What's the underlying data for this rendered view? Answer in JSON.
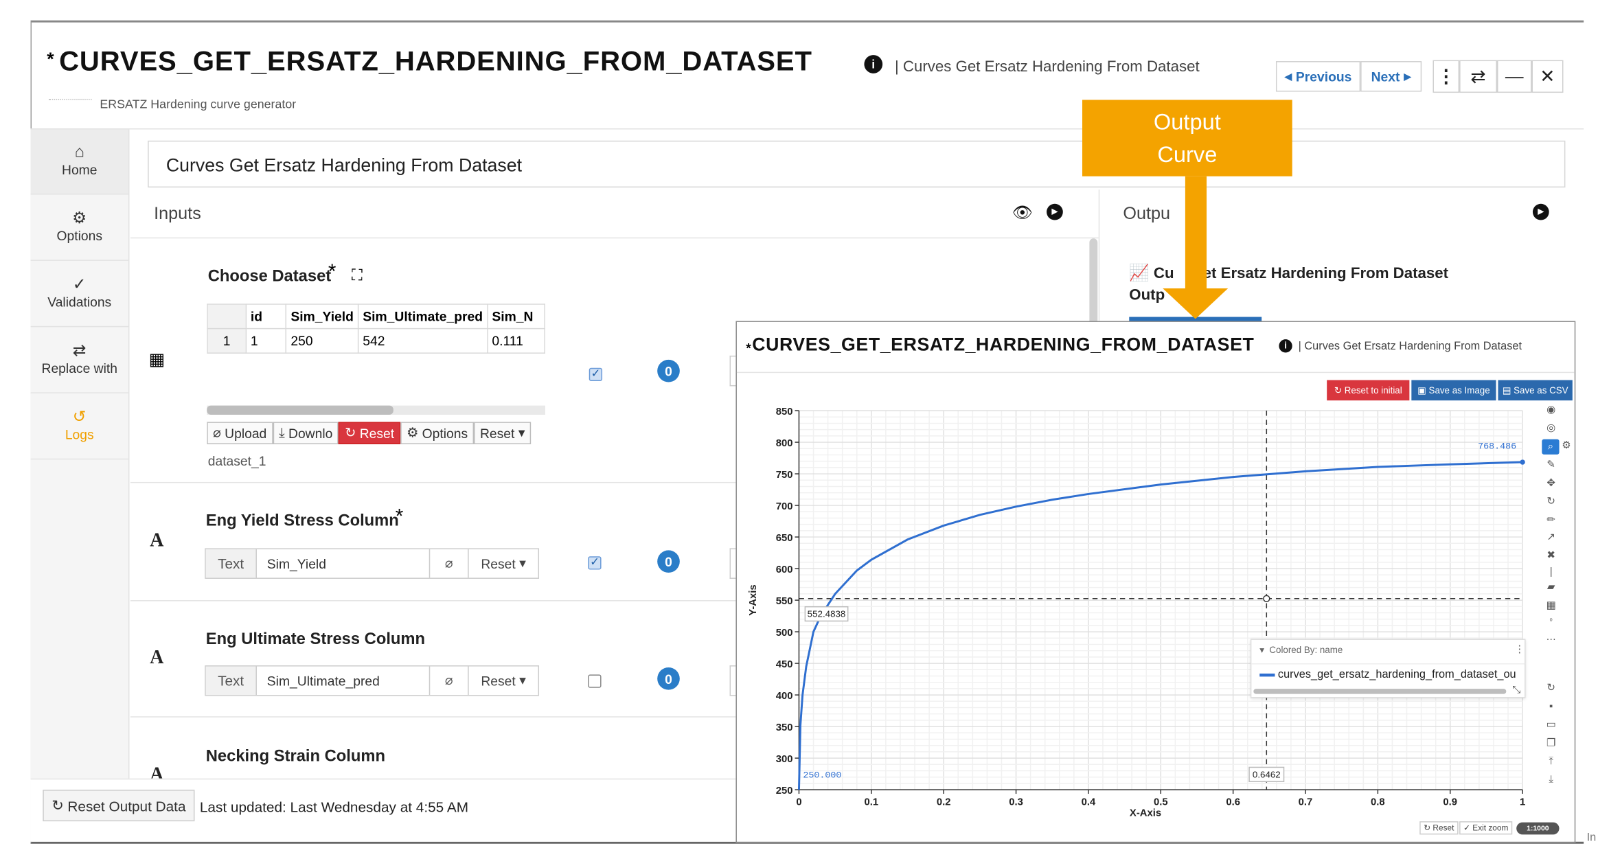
{
  "header": {
    "title_prefix": "*",
    "title": "CURVES_GET_ERSATZ_HARDENING_FROM_DATASET",
    "subtitle": "| Curves Get Ersatz Hardening From Dataset",
    "description": "ERSATZ Hardening curve generator",
    "previous_label": "Previous",
    "next_label": "Next"
  },
  "sidebar": {
    "items": [
      {
        "label": "Home"
      },
      {
        "label": "Options"
      },
      {
        "label": "Validations"
      },
      {
        "label": "Replace with"
      },
      {
        "label": "Logs"
      }
    ]
  },
  "name_field": {
    "value": "Curves Get Ersatz Hardening From Dataset"
  },
  "inputs": {
    "title": "Inputs",
    "dataset": {
      "label": "Choose Dataset",
      "required": "*",
      "columns": [
        "",
        "id",
        "Sim_Yield",
        "Sim_Ultimate_pred",
        "Sim_N"
      ],
      "rows": [
        [
          "1",
          "1",
          "250",
          "542",
          "0.111"
        ]
      ],
      "toolbar": [
        "Upload",
        "Downlo",
        "Reset",
        "Options",
        "Reset"
      ],
      "name": "dataset_1",
      "badge": "0"
    },
    "yield": {
      "label": "Eng Yield Stress Column",
      "required": "*",
      "prefix": "Text",
      "value": "Sim_Yield",
      "reset": "Reset",
      "badge": "0"
    },
    "ultimate": {
      "label": "Eng Ultimate Stress Column",
      "prefix": "Text",
      "value": "Sim_Ultimate_pred",
      "reset": "Reset",
      "badge": "0"
    },
    "necking": {
      "label": "Necking Strain Column"
    }
  },
  "outputs": {
    "title": "Outpu",
    "item_title": "Cu    Get Ersatz Hardening From Dataset",
    "item_title2": "Outp"
  },
  "footer": {
    "reset_label": "Reset Output Data",
    "last_updated": "Last updated: Last Wednesday at 4:55 AM"
  },
  "callout": {
    "line1": "Output",
    "line2": "Curve"
  },
  "popup": {
    "title_prefix": "*",
    "title": "CURVES_GET_ERSATZ_HARDENING_FROM_DATASET",
    "subtitle": "| Curves Get Ersatz Hardening From Dataset",
    "btn_reset_initial": "Reset to initial",
    "btn_save_image": "Save as Image",
    "btn_save_csv": "Save as CSV",
    "legend_header": "Colored By: name",
    "legend_item": "curves_get_ersatz_hardening_from_dataset_ou",
    "zoom_reset": "Reset",
    "exit_zoom": "Exit zoom",
    "scale_badge": "1:1000"
  },
  "chart_data": {
    "type": "line",
    "xlabel": "X-Axis",
    "ylabel": "Y-Axis",
    "xlim": [
      0,
      1
    ],
    "ylim": [
      250,
      850
    ],
    "xticks": [
      "0",
      "0.1",
      "0.2",
      "0.3",
      "0.4",
      "0.5",
      "0.6",
      "0.7",
      "0.8",
      "0.9",
      "1"
    ],
    "yticks": [
      "250",
      "300",
      "350",
      "400",
      "450",
      "500",
      "550",
      "600",
      "650",
      "700",
      "750",
      "800",
      "850"
    ],
    "grid": true,
    "series": [
      {
        "name": "curves_get_ersatz_hardening_from_dataset_ou",
        "color": "#2f6fd0",
        "x": [
          0,
          0.002,
          0.005,
          0.01,
          0.02,
          0.03,
          0.05,
          0.08,
          0.1,
          0.15,
          0.2,
          0.25,
          0.3,
          0.35,
          0.4,
          0.5,
          0.6,
          0.7,
          0.8,
          0.9,
          1.0
        ],
        "y": [
          250,
          352,
          400,
          445,
          500,
          525,
          560,
          597,
          614,
          646,
          668,
          685,
          698,
          709,
          718,
          733,
          745,
          754,
          761,
          765,
          768.486
        ]
      }
    ],
    "annotations": {
      "crosshair_x_label": "0.6462",
      "crosshair_y_label": "552.4838",
      "start_label": "250.000",
      "end_label": "768.486"
    }
  }
}
